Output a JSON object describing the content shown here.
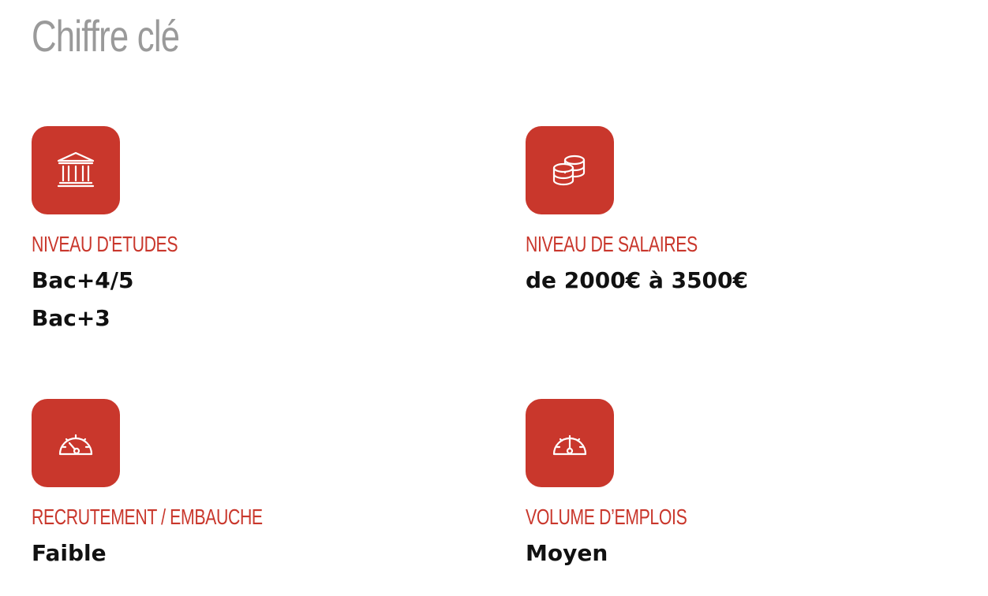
{
  "page": {
    "title": "Chiffre clé"
  },
  "colors": {
    "accent": "#c9372c",
    "title": "#9a9a9a",
    "text": "#111111"
  },
  "cards": [
    {
      "icon": "bank-icon",
      "label": "NIVEAU D'ETUDES",
      "values": [
        "Bac+4/5",
        "Bac+3"
      ]
    },
    {
      "icon": "coins-icon",
      "label": "NIVEAU DE SALAIRES",
      "values": [
        "de 2000€ à 3500€"
      ]
    },
    {
      "icon": "gauge-low-icon",
      "label": "RECRUTEMENT / EMBAUCHE",
      "values": [
        "Faible"
      ]
    },
    {
      "icon": "gauge-medium-icon",
      "label": "VOLUME D’EMPLOIS",
      "values": [
        "Moyen"
      ]
    }
  ]
}
